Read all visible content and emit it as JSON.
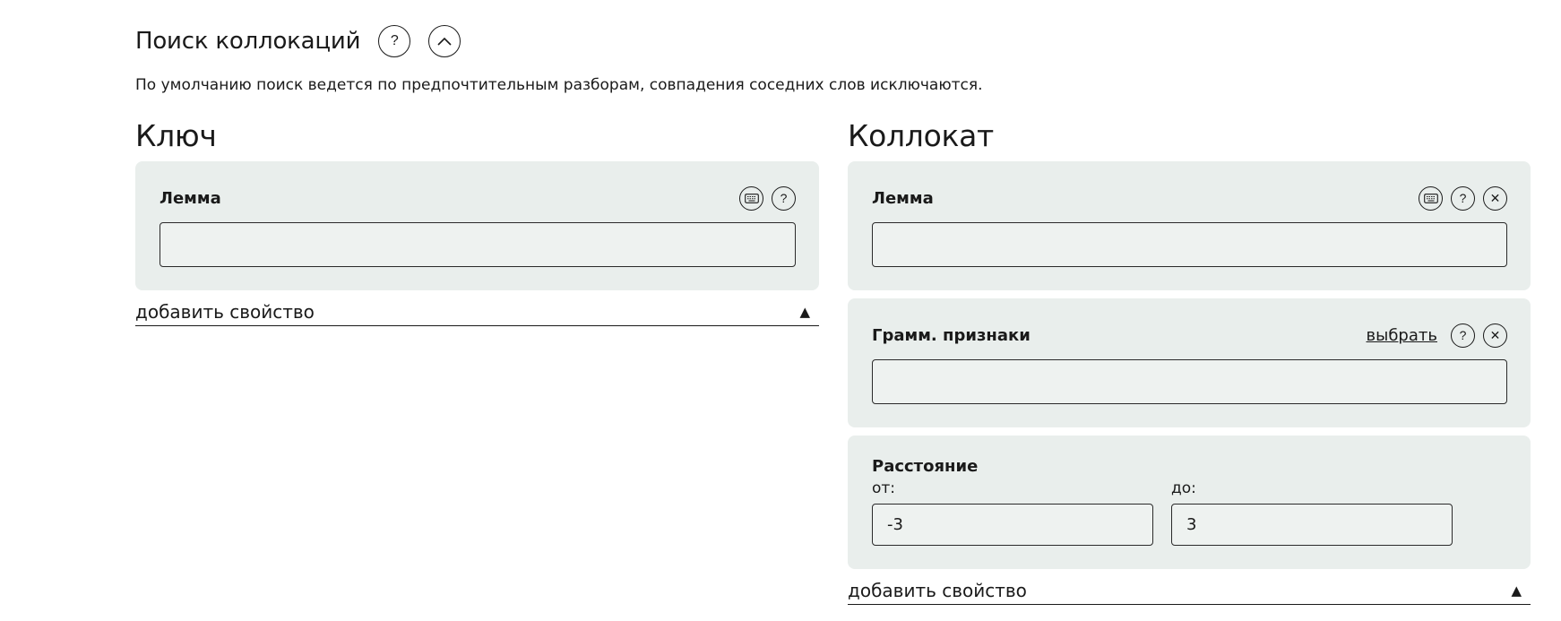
{
  "header": {
    "title": "Поиск коллокаций",
    "help_symbol": "?",
    "collapse_symbol": "︿"
  },
  "description": "По умолчанию поиск ведется по предпочтительным разборам, совпадения соседних слов исключаются.",
  "key": {
    "title": "Ключ",
    "lemma": {
      "label": "Лемма",
      "value": ""
    },
    "add_property": "добавить свойство",
    "add_property_symbol": "▲"
  },
  "collocate": {
    "title": "Коллокат",
    "lemma": {
      "label": "Лемма",
      "value": ""
    },
    "gram": {
      "label": "Грамм. признаки",
      "select_link": "выбрать",
      "value": ""
    },
    "distance": {
      "label": "Расстояние",
      "from_label": "от:",
      "from_value": "-3",
      "to_label": "до:",
      "to_value": "3"
    },
    "add_property": "добавить свойство",
    "add_property_symbol": "▲"
  },
  "icons": {
    "help": "?",
    "close": "✕"
  }
}
